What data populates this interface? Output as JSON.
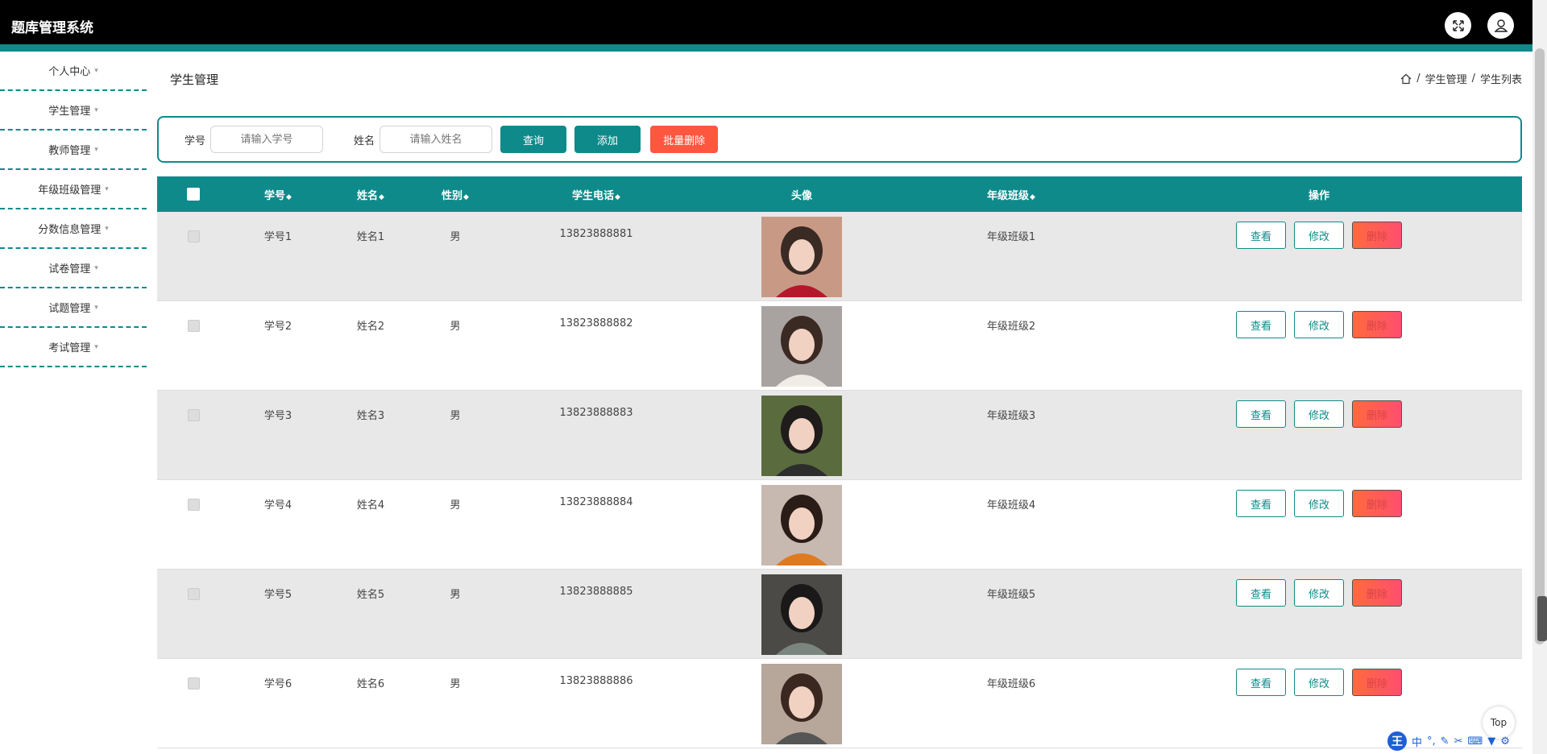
{
  "app": {
    "title": "题库管理系统"
  },
  "sidebar": {
    "items": [
      {
        "label": "个人中心"
      },
      {
        "label": "学生管理"
      },
      {
        "label": "教师管理"
      },
      {
        "label": "年级班级管理"
      },
      {
        "label": "分数信息管理"
      },
      {
        "label": "试卷管理"
      },
      {
        "label": "试题管理"
      },
      {
        "label": "考试管理"
      }
    ]
  },
  "header": {
    "page_title": "学生管理",
    "breadcrumb": [
      "学生管理",
      "学生列表"
    ]
  },
  "search": {
    "id_label": "学号",
    "id_placeholder": "请输入学号",
    "name_label": "姓名",
    "name_placeholder": "请输入姓名",
    "query_label": "查询",
    "add_label": "添加",
    "batch_delete_label": "批量删除"
  },
  "table": {
    "columns": [
      "学号",
      "姓名",
      "性别",
      "学生电话",
      "头像",
      "年级班级",
      "操作"
    ],
    "rows": [
      {
        "id": "学号1",
        "name": "姓名1",
        "sex": "男",
        "phone": "13823888881",
        "cls": "年级班级1"
      },
      {
        "id": "学号2",
        "name": "姓名2",
        "sex": "男",
        "phone": "13823888882",
        "cls": "年级班级2"
      },
      {
        "id": "学号3",
        "name": "姓名3",
        "sex": "男",
        "phone": "13823888883",
        "cls": "年级班级3"
      },
      {
        "id": "学号4",
        "name": "姓名4",
        "sex": "男",
        "phone": "13823888884",
        "cls": "年级班级4"
      },
      {
        "id": "学号5",
        "name": "姓名5",
        "sex": "男",
        "phone": "13823888885",
        "cls": "年级班级5"
      },
      {
        "id": "学号6",
        "name": "姓名6",
        "sex": "男",
        "phone": "13823888886",
        "cls": "年级班级6"
      }
    ],
    "actions": {
      "view": "查看",
      "edit": "修改",
      "delete": "删除"
    }
  },
  "float": {
    "top_label": "Top"
  },
  "ime": {
    "badge": "王",
    "mode": "中"
  },
  "colors": {
    "accent": "#0f8a8a",
    "danger": "#ff5640",
    "topbar": "#000000"
  },
  "icons": [
    "fullscreen-icon",
    "user-icon",
    "home-icon",
    "caret-down-icon",
    "sort-icon"
  ]
}
